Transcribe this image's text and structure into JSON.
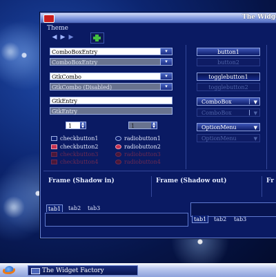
{
  "window": {
    "title": "The Widget Factory"
  },
  "menu": {
    "theme": "Theme"
  },
  "toolbar": {
    "back_icon": "arrow-left-icon",
    "forward_icon": "arrow-right-icon",
    "add_icon": "plus-icon"
  },
  "combos": [
    {
      "text": "ComboBoxEntry",
      "arrow": "▾"
    },
    {
      "text": "ComboBoxEntry",
      "arrow": "▾"
    },
    {
      "text": "GtkCombo",
      "arrow": "▾"
    },
    {
      "text": "GtkCombo (Disabled)",
      "arrow": "▾"
    }
  ],
  "entries": [
    {
      "value": "GtkEntry"
    },
    {
      "value": "GtkEntry"
    }
  ],
  "spinners": [
    {
      "value": "1"
    },
    {
      "value": "1"
    }
  ],
  "checks": [
    {
      "label": "checkbutton1"
    },
    {
      "label": "checkbutton2"
    },
    {
      "label": "checkbutton3"
    },
    {
      "label": "checkbutton4"
    }
  ],
  "radios": [
    {
      "label": "radiobutton1"
    },
    {
      "label": "radiobutton2"
    },
    {
      "label": "radiobutton3"
    },
    {
      "label": "radiobutton4"
    }
  ],
  "buttons": {
    "button1": "button1",
    "button2": "button2",
    "togglebutton1": "togglebutton1",
    "togglebutton2": "togglebutton2",
    "combobox1": "ComboBox",
    "combobox2": "ComboBox",
    "optionmenu1": "OptionMenu",
    "optionmenu2": "OptionMenu"
  },
  "frames": {
    "shadow_in": "Frame (Shadow in)",
    "shadow_out": "Frame (Shadow out)",
    "third": "Fr"
  },
  "notebook1": {
    "tabs": [
      "tab1",
      "tab2",
      "tab3"
    ]
  },
  "notebook2": {
    "tabs": [
      "tab1",
      "tab2",
      "tab3"
    ]
  },
  "taskbar": {
    "item": "The Widget Factory"
  },
  "colors": {
    "window_bg": "#0a1a63",
    "accent": "#c7304f",
    "titlebar": "#7f98df"
  }
}
